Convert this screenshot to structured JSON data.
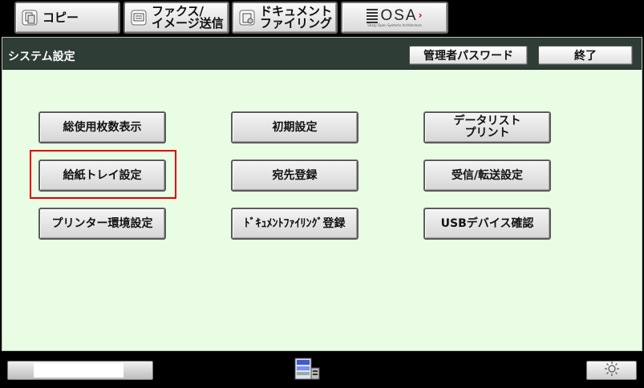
{
  "tabs": {
    "copy": "コピー",
    "fax_line1": "ファクス/",
    "fax_line2": "イメージ送信",
    "doc_line1": "ドキュメント",
    "doc_line2": "ファイリング",
    "osa_logo": "OSA",
    "osa_tagline": "Sharp Open Systems Architecture"
  },
  "header": {
    "title": "システム設定",
    "admin_password": "管理者パスワード",
    "end": "終了"
  },
  "buttons": {
    "total_count": "総使用枚数表示",
    "initial_settings": "初期設定",
    "data_list_print": "データリスト\nプリント",
    "paper_tray_settings": "給紙トレイ設定",
    "address_registration": "宛先登録",
    "receive_forward_settings": "受信/転送設定",
    "printer_settings": "プリンター環境設定",
    "doc_filing_registration": "ﾄﾞｷｭﾒﾝﾄﾌｧｲﾘﾝｸﾞ登録",
    "usb_device_check": "USBデバイス確認"
  },
  "colors": {
    "panel_bg": "#e8fde3",
    "titlebar_bg": "#2f3d37",
    "highlight": "#e00000"
  }
}
